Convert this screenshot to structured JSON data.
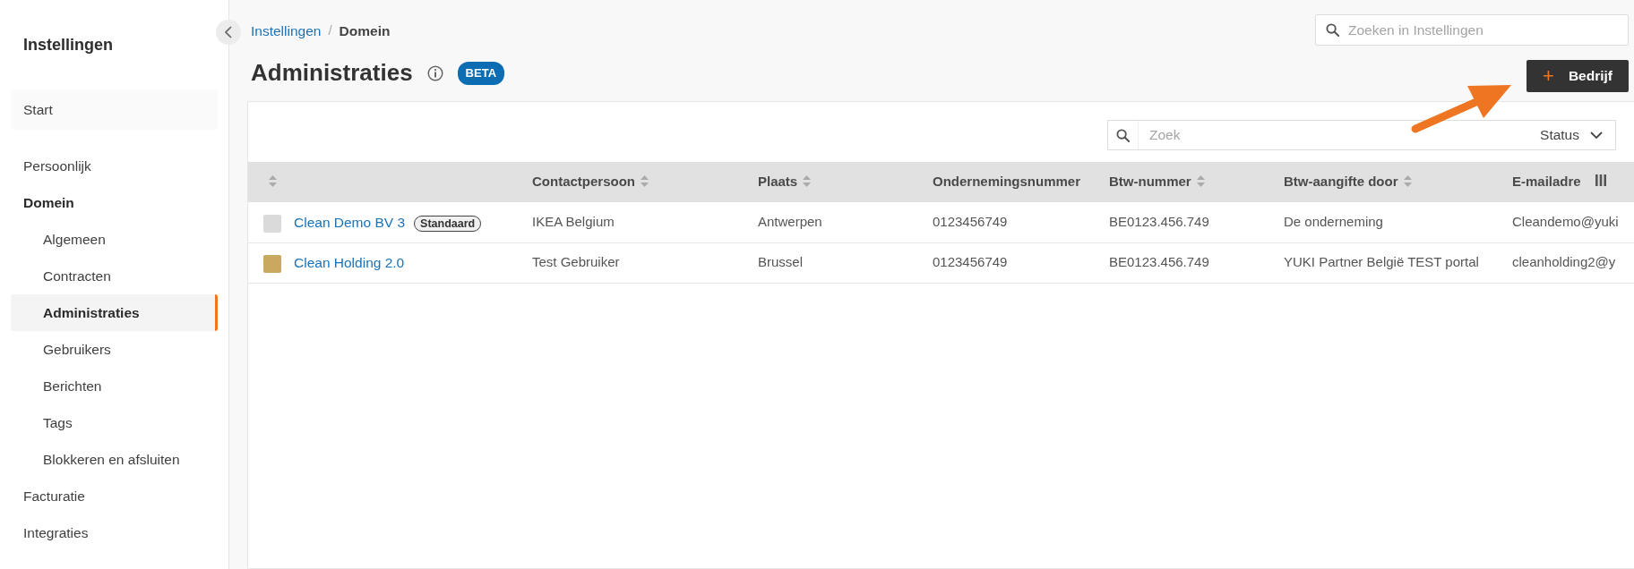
{
  "sidebar": {
    "title": "Instellingen",
    "items": [
      {
        "label": "Start",
        "kind": "home",
        "selected": false
      },
      {
        "label": "Persoonlijk",
        "kind": "link",
        "selected": false
      },
      {
        "label": "Domein",
        "kind": "link",
        "selected": false,
        "expanded": true,
        "children": [
          {
            "label": "Algemeen",
            "selected": false
          },
          {
            "label": "Contracten",
            "selected": false
          },
          {
            "label": "Administraties",
            "selected": true
          },
          {
            "label": "Gebruikers",
            "selected": false
          },
          {
            "label": "Berichten",
            "selected": false
          },
          {
            "label": "Tags",
            "selected": false
          },
          {
            "label": "Blokkeren en afsluiten",
            "selected": false
          }
        ]
      },
      {
        "label": "Facturatie",
        "kind": "link",
        "selected": false
      },
      {
        "label": "Integraties",
        "kind": "link",
        "selected": false
      }
    ]
  },
  "breadcrumb": {
    "separator": "/",
    "items": [
      {
        "label": "Instellingen",
        "kind": "link"
      },
      {
        "label": "Domein",
        "kind": "current"
      }
    ]
  },
  "page_title": "Administraties",
  "title_badge": "BETA",
  "settings_search": {
    "placeholder": "Zoeken in Instellingen"
  },
  "add_button": {
    "icon": "+",
    "label": "Bedrijf"
  },
  "filter": {
    "placeholder": "Zoek",
    "status_label": "Status"
  },
  "table": {
    "columns": [
      {
        "sortable": true
      },
      {
        "label": "Contactpersoon",
        "sortable": true
      },
      {
        "label": "Plaats",
        "sortable": true
      },
      {
        "label": "Ondernemingsnummer",
        "sortable": false
      },
      {
        "label": "Btw-nummer",
        "sortable": true
      },
      {
        "label": "Btw-aangifte door",
        "sortable": true
      },
      {
        "label": "E-mailadre",
        "sortable": false
      }
    ],
    "rows": [
      {
        "badge": "Standaard",
        "cells": [
          "Clean Demo BV 3",
          "IKEA Belgium",
          "Antwerpen",
          "0123456749",
          "BE0123.456.749",
          "De onderneming",
          "Cleandemo@yuki"
        ]
      },
      {
        "cells": [
          "Clean Holding 2.0",
          "Test Gebruiker",
          "Brussel",
          "0123456749",
          "BE0123.456.749",
          "YUKI Partner België TEST portal",
          "cleanholding2@y"
        ]
      }
    ]
  }
}
